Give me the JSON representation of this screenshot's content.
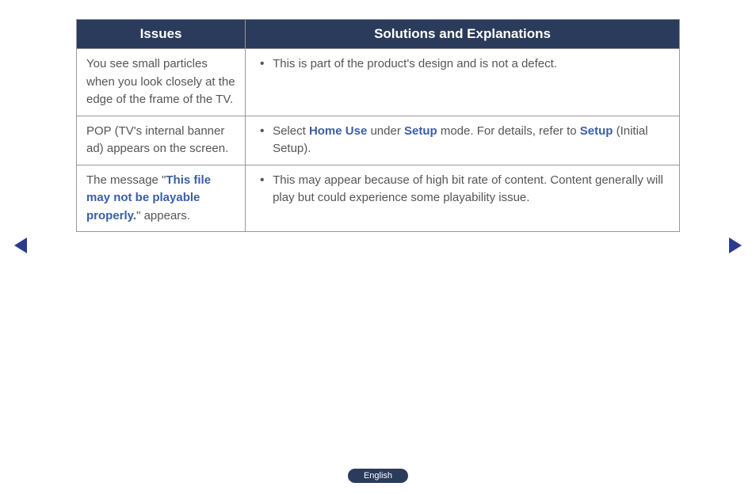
{
  "table": {
    "headers": {
      "issues": "Issues",
      "solutions": "Solutions and Explanations"
    },
    "rows": [
      {
        "issue_parts": [
          {
            "text": "You see small particles when you look closely at the edge of the frame of the TV.",
            "highlight": false
          }
        ],
        "solution_parts": [
          {
            "text": "This is part of the product's design and is not a defect.",
            "highlight": false
          }
        ]
      },
      {
        "issue_parts": [
          {
            "text": "POP (TV's internal banner ad) appears on the screen.",
            "highlight": false
          }
        ],
        "solution_parts": [
          {
            "text": "Select ",
            "highlight": false
          },
          {
            "text": "Home Use",
            "highlight": true
          },
          {
            "text": " under ",
            "highlight": false
          },
          {
            "text": "Setup",
            "highlight": true
          },
          {
            "text": " mode. For details, refer to ",
            "highlight": false
          },
          {
            "text": "Setup",
            "highlight": true
          },
          {
            "text": " (Initial Setup).",
            "highlight": false
          }
        ]
      },
      {
        "issue_parts": [
          {
            "text": "The message \"",
            "highlight": false
          },
          {
            "text": "This file may not be playable properly.",
            "highlight": true
          },
          {
            "text": "\" appears.",
            "highlight": false
          }
        ],
        "solution_parts": [
          {
            "text": "This may appear because of high bit rate of content. Content generally will play but could experience some playability issue.",
            "highlight": false
          }
        ]
      }
    ]
  },
  "footer": {
    "language": "English"
  }
}
